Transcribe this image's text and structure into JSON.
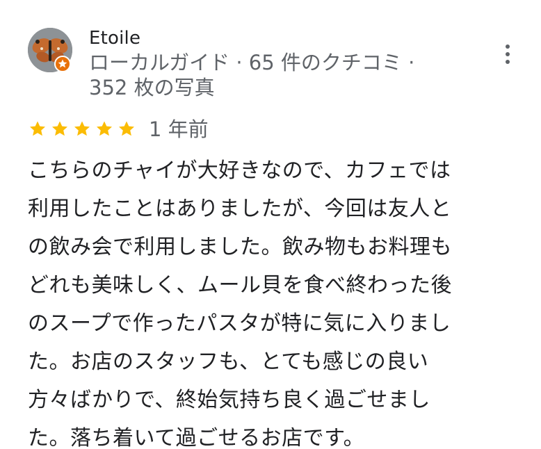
{
  "reviewer": {
    "name": "Etoile",
    "meta_line_1": "ローカルガイド · 65 件のクチコミ ·",
    "meta_line_2": "352 枚の写真",
    "avatar_icon": "butterfly-photo",
    "badge_icon": "local-guide-star-icon"
  },
  "menu": {
    "icon": "more-vert-icon"
  },
  "rating": {
    "stars": 5,
    "max_stars": 5,
    "star_color": "#fbbc04",
    "date": "1 年前"
  },
  "review": {
    "lines": [
      "こちらのチャイが大好きなので、カフェでは",
      "利用したことはありましたが、今回は友人と",
      "の飲み会で利用しました。飲み物もお料理も",
      "どれも美味しく、ムール貝を食べ終わった後",
      "のスープで作ったパスタが特に気に入りまし",
      "た。お店のスタッフも、とても感じの良い",
      "方々ばかりで、終始気持ち良く過ごせまし",
      "た。落ち着いて過ごせるお店です。"
    ]
  },
  "colors": {
    "text_primary": "#202124",
    "text_secondary": "#5f6368",
    "badge": "#e8710a"
  }
}
